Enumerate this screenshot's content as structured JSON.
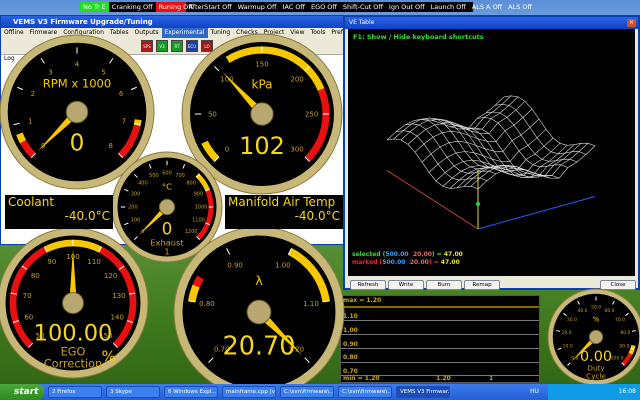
{
  "status_bar": [
    "No Tr E",
    "Cranking Off",
    "Runing Off",
    "AfterStart Off",
    "Warmup Off",
    "IAC Off",
    "EGO Off",
    "Shift-Cut Off",
    "Ign Out Off",
    "Launch Off",
    "ALS A Off",
    "ALS Off"
  ],
  "status_colors": {
    "No Tr E": "#22dd22",
    "Runing Off": "#e81010"
  },
  "main_window": {
    "title": "VEMS V3 Firmware Upgrade/Tuning",
    "menu": [
      "Offline",
      "Firmware",
      "Configuration",
      "Tables",
      "Outputs",
      "Experimental",
      "Tuning",
      "Checks",
      "Project",
      "View",
      "Tools",
      "Preferences",
      "Dev",
      "Help"
    ],
    "selected_menu": "Experimental",
    "toolbar": [
      "SPS",
      "V3",
      "RT",
      "ECU",
      "LO"
    ],
    "log_tab": "Log"
  },
  "ve_table": {
    "title": "VE Table",
    "hint": "F1: Show / Hide keyboard shortcuts",
    "selected": {
      "label": "selected",
      "x": "500.00",
      "y": "20.00",
      "value": "47.00"
    },
    "marked": {
      "label": "marked",
      "x": "500.00",
      "y": "20.00",
      "value": "47.00"
    },
    "buttons": [
      "Refresh",
      "Write",
      "Burn",
      "Remap",
      "Close"
    ]
  },
  "gauges": [
    {
      "id": "rpm",
      "title": "RPM x 1000",
      "value": "0",
      "ticks": [
        "0",
        "1",
        "2",
        "3",
        "4",
        "5",
        "6",
        "7",
        "8"
      ],
      "needle_fraction": 0.0
    },
    {
      "id": "map",
      "title": "kPa",
      "value": "102",
      "ticks": [
        "0",
        "50",
        "100",
        "150",
        "200",
        "250",
        "300"
      ],
      "needle_fraction": 0.34
    },
    {
      "id": "egt",
      "title": "°C",
      "value": "0",
      "sub": "Exhaust",
      "sub2": "1",
      "ticks": [
        "0",
        "100",
        "200",
        "300",
        "400",
        "500",
        "600",
        "700",
        "800",
        "900",
        "1000",
        "1100",
        "1200"
      ],
      "needle_fraction": 0.0
    },
    {
      "id": "ego",
      "title": "",
      "value": "100.00",
      "sub": "EGO",
      "sub2": "Correction",
      "unit": "%",
      "ticks": [
        "50",
        "60",
        "70",
        "80",
        "90",
        "100",
        "110",
        "120",
        "130",
        "140",
        "150"
      ],
      "needle_fraction": 0.5
    },
    {
      "id": "lambda",
      "title": "λ",
      "value": "20.70",
      "ticks": [
        "0.70",
        "0.80",
        "0.90",
        "1.00",
        "1.10",
        "1.20"
      ],
      "needle_fraction": 1.0
    },
    {
      "id": "duty",
      "title": "%",
      "value": "0.00",
      "sub": "Duty",
      "sub2": "Cycle",
      "ticks": [
        "0.0",
        "10.0",
        "20.0",
        "30.0",
        "40.0",
        "50.0",
        "60.0",
        "70.0",
        "80.0",
        "90.0",
        "100.0"
      ],
      "needle_fraction": 0.0
    }
  ],
  "coolant": {
    "label": "Coolant",
    "value": "-40.0°C"
  },
  "mat": {
    "label": "Manifold Air Temp",
    "value": "-40.0°C"
  },
  "plot": {
    "max": "max = 1.20",
    "levels": [
      "1.10",
      "1.00",
      "0.90",
      "0.80",
      "0.70"
    ],
    "min": "min = 1.20",
    "current": "1.20",
    "count": "1"
  },
  "taskbar": {
    "start": "start",
    "items": [
      "2 Firefox",
      "3 Skype",
      "6 Windows Expl...",
      "mainframe.cpp [v...",
      "C:\\svn\\firmware\\...",
      "C:\\svn\\firmware\\...",
      "VEMS V3 Firmwar..."
    ],
    "lang": "HU",
    "clock": "16:08"
  },
  "colors": {
    "gauge_text": "#f7c800",
    "red_zone": "#e81010",
    "bezel": "#c8b878"
  }
}
